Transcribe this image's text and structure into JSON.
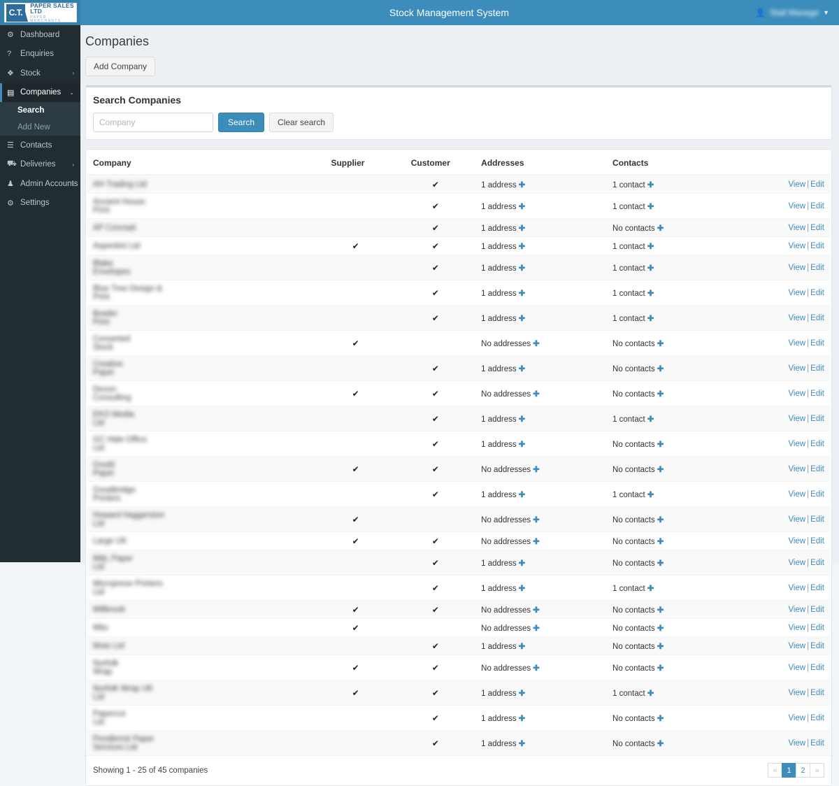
{
  "app": {
    "title": "Stock Management System",
    "logo": {
      "mark": "C.T.",
      "line1": "PAPER SALES LTD",
      "line2": "PAPER MERCHANTS"
    },
    "user": {
      "name": "Stall Manage",
      "icon": "user-icon",
      "caret": "chevron-down-icon"
    },
    "accent": "#3c8dbc",
    "sidebar_bg": "#222d32"
  },
  "sidebar": {
    "items": [
      {
        "label": "Dashboard",
        "icon": "dashboard-icon",
        "arrow": "",
        "active": false
      },
      {
        "label": "Enquiries",
        "icon": "question-icon",
        "arrow": "",
        "active": false
      },
      {
        "label": "Stock",
        "icon": "cubes-icon",
        "arrow": "›",
        "active": false
      },
      {
        "label": "Companies",
        "icon": "building-icon",
        "arrow": "⌄",
        "active": true
      },
      {
        "label": "Contacts",
        "icon": "address-card-icon",
        "arrow": "",
        "active": false
      },
      {
        "label": "Deliveries",
        "icon": "truck-icon",
        "arrow": "›",
        "active": false
      },
      {
        "label": "Admin Accounts",
        "icon": "users-icon",
        "arrow": "›",
        "active": false
      },
      {
        "label": "Settings",
        "icon": "gears-icon",
        "arrow": "",
        "active": false
      }
    ],
    "submenu": [
      {
        "label": "Search",
        "active": true
      },
      {
        "label": "Add New",
        "active": false
      }
    ]
  },
  "page": {
    "title": "Companies",
    "add_button": "Add Company"
  },
  "search": {
    "heading": "Search Companies",
    "input_value": "",
    "placeholder": "Company",
    "search_label": "Search",
    "clear_label": "Clear search"
  },
  "table": {
    "columns": [
      "Company",
      "Supplier",
      "Customer",
      "Addresses",
      "Contacts"
    ],
    "tick_glyph": "✔",
    "plus_glyph": "✚",
    "view_label": "View",
    "edit_label": "Edit",
    "separator": "|",
    "rows": [
      {
        "company": "AH Trading Ltd",
        "name_width": 82,
        "supplier": false,
        "customer": true,
        "addresses": "1 address",
        "contacts": "1 contact"
      },
      {
        "company": "Ancient House Print",
        "name_width": 100,
        "supplier": false,
        "customer": true,
        "addresses": "1 address",
        "contacts": "1 contact"
      },
      {
        "company": "AP Concept",
        "name_width": 62,
        "supplier": false,
        "customer": true,
        "addresses": "1 address",
        "contacts": "No contacts"
      },
      {
        "company": "Aspentint Ltd",
        "name_width": 70,
        "supplier": true,
        "customer": true,
        "addresses": "1 address",
        "contacts": "1 contact"
      },
      {
        "company": "Blake Envelopes",
        "name_width": 80,
        "supplier": false,
        "customer": true,
        "addresses": "1 address",
        "contacts": "1 contact"
      },
      {
        "company": "Blue Tree Design & Print",
        "name_width": 122,
        "supplier": false,
        "customer": true,
        "addresses": "1 address",
        "contacts": "1 contact"
      },
      {
        "company": "Bowler Print",
        "name_width": 60,
        "supplier": false,
        "customer": true,
        "addresses": "1 address",
        "contacts": "1 contact"
      },
      {
        "company": "Converted Stock",
        "name_width": 80,
        "supplier": true,
        "customer": false,
        "addresses": "No addresses",
        "contacts": "No contacts"
      },
      {
        "company": "Creative Paper",
        "name_width": 68,
        "supplier": false,
        "customer": true,
        "addresses": "1 address",
        "contacts": "No contacts"
      },
      {
        "company": "Devon Consulting",
        "name_width": 88,
        "supplier": true,
        "customer": true,
        "addresses": "No addresses",
        "contacts": "No contacts"
      },
      {
        "company": "EKO Media Ltd",
        "name_width": 72,
        "supplier": false,
        "customer": true,
        "addresses": "1 address",
        "contacts": "1 contact"
      },
      {
        "company": "GC Hale Office Ltd",
        "name_width": 92,
        "supplier": false,
        "customer": true,
        "addresses": "1 address",
        "contacts": "No contacts"
      },
      {
        "company": "Gould Paper",
        "name_width": 62,
        "supplier": true,
        "customer": true,
        "addresses": "No addresses",
        "contacts": "No contacts"
      },
      {
        "company": "Greatbridge Printers",
        "name_width": 94,
        "supplier": false,
        "customer": true,
        "addresses": "1 address",
        "contacts": "1 contact"
      },
      {
        "company": "Howard Haggerston Ltd",
        "name_width": 110,
        "supplier": true,
        "customer": false,
        "addresses": "No addresses",
        "contacts": "No contacts"
      },
      {
        "company": "Large UK",
        "name_width": 50,
        "supplier": true,
        "customer": true,
        "addresses": "No addresses",
        "contacts": "No contacts"
      },
      {
        "company": "M&L Paper Ltd",
        "name_width": 72,
        "supplier": false,
        "customer": true,
        "addresses": "1 address",
        "contacts": "No contacts"
      },
      {
        "company": "Microprese Printers Ltd",
        "name_width": 112,
        "supplier": false,
        "customer": true,
        "addresses": "1 address",
        "contacts": "1 contact"
      },
      {
        "company": "Millbrook",
        "name_width": 52,
        "supplier": true,
        "customer": true,
        "addresses": "No addresses",
        "contacts": "No contacts"
      },
      {
        "company": "Mitu",
        "name_width": 30,
        "supplier": true,
        "customer": false,
        "addresses": "No addresses",
        "contacts": "No contacts"
      },
      {
        "company": "Moto Ltd",
        "name_width": 48,
        "supplier": false,
        "customer": true,
        "addresses": "1 address",
        "contacts": "No contacts"
      },
      {
        "company": "Norfolk Wrap",
        "name_width": 66,
        "supplier": true,
        "customer": true,
        "addresses": "No addresses",
        "contacts": "No contacts"
      },
      {
        "company": "Norfolk Wrap UK Ltd",
        "name_width": 96,
        "supplier": true,
        "customer": true,
        "addresses": "1 address",
        "contacts": "1 contact"
      },
      {
        "company": "Papercut Ltd",
        "name_width": 62,
        "supplier": false,
        "customer": true,
        "addresses": "1 address",
        "contacts": "No contacts"
      },
      {
        "company": "Pendlerick Paper Services Ltd",
        "name_width": 134,
        "supplier": false,
        "customer": true,
        "addresses": "1 address",
        "contacts": "No contacts"
      }
    ]
  },
  "footer": {
    "showing": "Showing 1 - 25 of 45 companies",
    "pagination": [
      {
        "label": "«",
        "state": "disabled"
      },
      {
        "label": "1",
        "state": "current"
      },
      {
        "label": "2",
        "state": "normal"
      },
      {
        "label": "»",
        "state": "disabled"
      }
    ]
  }
}
